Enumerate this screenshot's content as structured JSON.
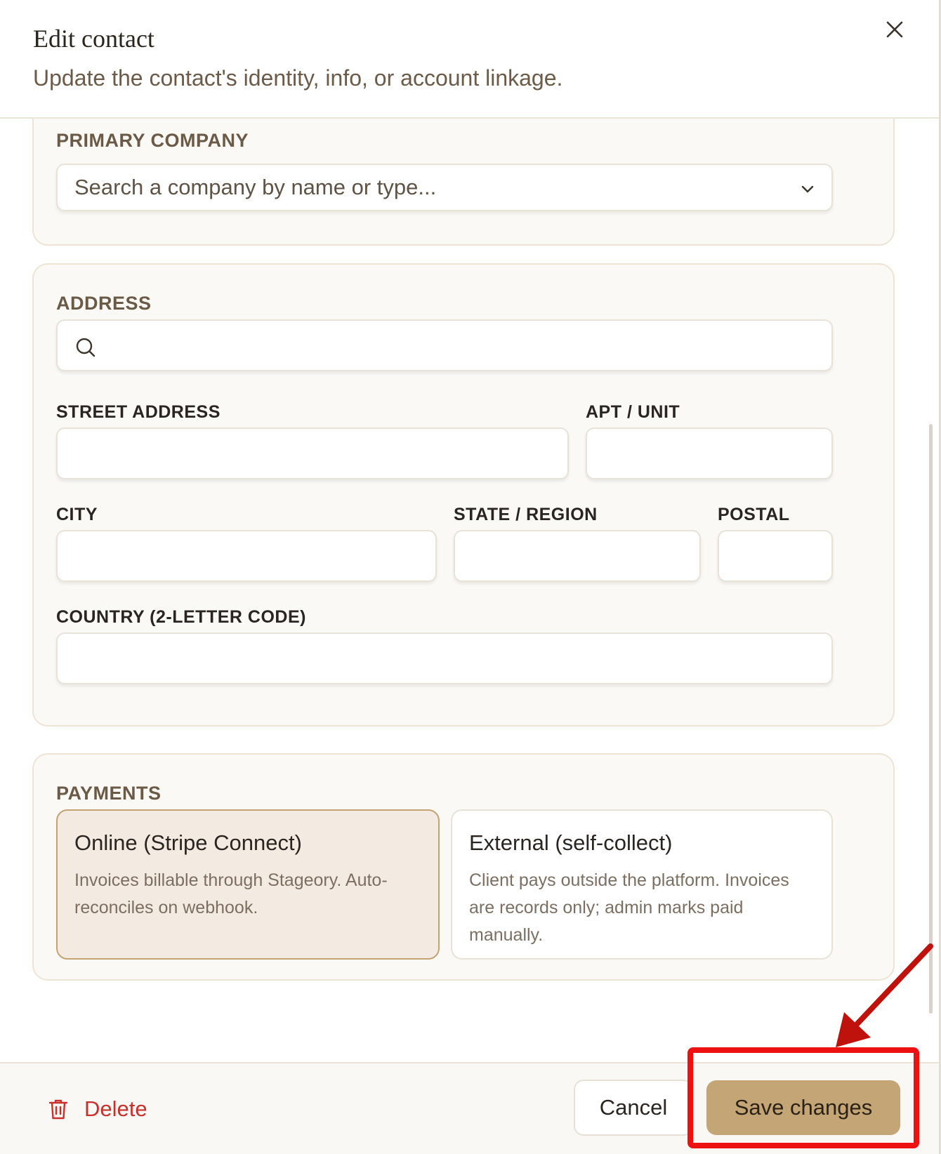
{
  "dialog": {
    "title": "Edit contact",
    "subtitle": "Update the contact's identity, info, or account linkage."
  },
  "company": {
    "section_label": "PRIMARY COMPANY",
    "placeholder": "Search a company by name or type..."
  },
  "address": {
    "section_label": "ADDRESS",
    "search_value": "",
    "street_label": "STREET ADDRESS",
    "apt_label": "APT / UNIT",
    "city_label": "CITY",
    "state_label": "STATE / REGION",
    "postal_label": "POSTAL",
    "country_label": "COUNTRY (2-LETTER CODE)"
  },
  "payments": {
    "section_label": "PAYMENTS",
    "options": [
      {
        "title": "Online (Stripe Connect)",
        "description": "Invoices billable through Stageory. Auto-reconciles on webhook.",
        "selected": true
      },
      {
        "title": "External (self-collect)",
        "description": "Client pays outside the platform. Invoices are records only; admin marks paid manually.",
        "selected": false
      }
    ]
  },
  "footer": {
    "delete_label": "Delete",
    "cancel_label": "Cancel",
    "save_label": "Save changes"
  },
  "colors": {
    "accent": "#c4a676",
    "danger": "#c9302c",
    "annotation": "#ee1111"
  },
  "icons": {
    "close": "close-icon",
    "chevron": "chevron-down-icon",
    "search": "search-icon",
    "delete": "trash-icon"
  }
}
